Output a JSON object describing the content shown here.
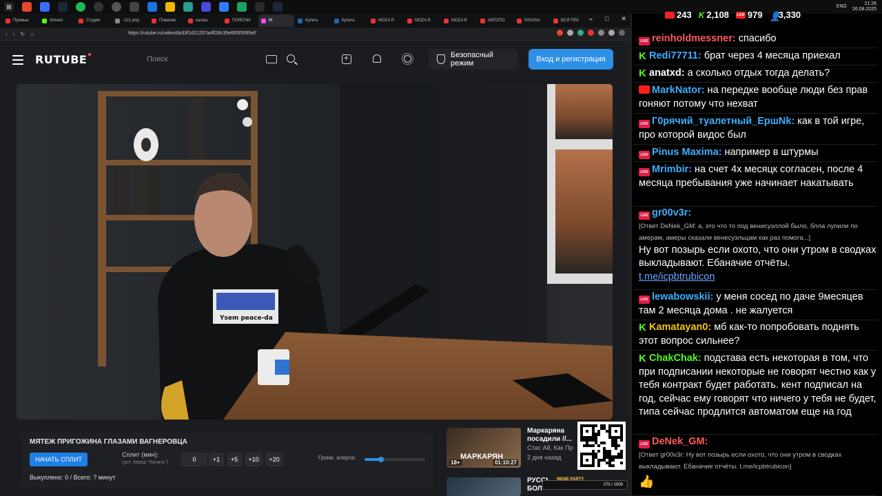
{
  "taskbar": {
    "clock_time": "21:26",
    "clock_date": "26.08.2025",
    "lang": "ENG"
  },
  "browser": {
    "tabs": [
      {
        "label": "Прямые",
        "color": "#e33"
      },
      {
        "label": "Stream",
        "color": "#53fc18"
      },
      {
        "label": "Студия",
        "color": "#e33"
      },
      {
        "label": "-221.png",
        "color": "#888"
      },
      {
        "label": "Поваляе",
        "color": "#e33"
      },
      {
        "label": "калаш",
        "color": "#e33"
      },
      {
        "label": "ПОЯСНИ",
        "color": "#e33"
      },
      {
        "label": "М",
        "color": "#f4f",
        "active": true
      },
      {
        "label": "Купить",
        "color": "#26a"
      },
      {
        "label": "Купить",
        "color": "#26a"
      },
      {
        "label": "MOZA R",
        "color": "#e33"
      },
      {
        "label": "MOZA R",
        "color": "#e33"
      },
      {
        "label": "MOZA R",
        "color": "#e33"
      },
      {
        "label": "АВТОПО",
        "color": "#e33"
      },
      {
        "label": "NISSAN",
        "color": "#e33"
      },
      {
        "label": "ВСЯ ПРА",
        "color": "#e33"
      }
    ],
    "url": "https://rutube.ru/video/da33f1d21207a4ff28c35e665f5595ef/"
  },
  "header": {
    "logo": "RUTUBE",
    "search_placeholder": "Поиск",
    "safe_mode_label": "Безопасный режим",
    "login_label": "Вход и регистрация"
  },
  "split": {
    "title": "МЯТЕЖ ПРИГОЖИНА ГЛАЗАМИ ВАГНЕРОВЦА",
    "start_label": "НАЧАТЬ СПЛИТ",
    "minutes_label": "Сплит (мин):",
    "minutes_hint": "(уст. перед \"Начать\")",
    "minutes_value": "0",
    "buttons": [
      "+1",
      "+5",
      "+10",
      "+20"
    ],
    "volume_label": "Громк. алерта:",
    "volume_level": 0.27,
    "status": "Выкуплено: 0 / Всего: ? минут"
  },
  "recommendations": [
    {
      "title": "Маркаряна посадили //...",
      "channel": "Стас Ай, Как Пр",
      "age": "2 дня назад",
      "thumb_text": "МАРКАРЯН",
      "age_badge": "18+",
      "duration": "01:10:27"
    },
    {
      "title": "РУССКИЕ БОЛ",
      "channel": "",
      "age": "",
      "thumb_text": "",
      "age_badge": "",
      "duration": ""
    }
  ],
  "meme_bar": {
    "title": "MEME PARTY",
    "progress": "270 / 1500"
  },
  "chat": {
    "stats": {
      "youtube": "243",
      "kick": "2,108",
      "live": "979",
      "viewers": "3,330"
    },
    "messages": [
      {
        "platform": "live",
        "nick": "reinholdmessner:",
        "nick_color": "#ff5a5a",
        "text": "спасибо"
      },
      {
        "platform": "kick",
        "nick": "Redi77711:",
        "nick_color": "#3ab0ff",
        "text": "брат через 4 месяца приехал"
      },
      {
        "platform": "kick",
        "nick": "anatxd:",
        "nick_color": "#ffffff",
        "text": "а сколько отдых тогда делать?"
      },
      {
        "platform": "yt",
        "nick": "MarkNator:",
        "nick_color": "#3ab0ff",
        "text": "на передке вообще люди без прав гоняют потому что нехват"
      },
      {
        "platform": "live",
        "nick": "Г0рячий_туалетный_ЕршNk:",
        "nick_color": "#3ab0ff",
        "text": "как в той игре, про которой видос был"
      },
      {
        "platform": "live",
        "nick": "Pinus Maxima:",
        "nick_color": "#3ab0ff",
        "text": "например в штурмы"
      },
      {
        "platform": "live",
        "nick": "Mrimbir:",
        "nick_color": "#3ab0ff",
        "text": "на счет 4х месяцк согласен, после 4 месяца пребывания уже начинает накатывать"
      },
      {
        "platform": "live",
        "nick": "gr00v3r:",
        "nick_color": "#3ab0ff",
        "reply": "[Ответ DeNek_GM: а, это что то под венисуэллой было, блла лупили по амерам, амеры сказали венесуэльцам как раз помога...]",
        "text": "Ну вот позырь если охото, что они утром в сводках выкладывают. Ебаначие отчёты.",
        "link": "t.me/icpbtrubicon"
      },
      {
        "platform": "live",
        "nick": "lewabowskii:",
        "nick_color": "#3ab0ff",
        "text": "у меня сосед по даче 9месяцев там 2 месяца дома . не жалуется"
      },
      {
        "platform": "kick",
        "nick": "Kamatayan0:",
        "nick_color": "#f5c518",
        "text": "мб как-то попробовать поднять этот вопрос сильнее?"
      },
      {
        "platform": "kick",
        "nick": "ChakChak:",
        "nick_color": "#53fc18",
        "text": "подстава есть некоторая в том, что при подписании некоторые не говорят честно как у тебя контракт будет работать. кент подписал на год, сейчас ему говорят что ничего у тебя не будет, типа сейчас продлится автоматом еще на год"
      },
      {
        "platform": "live",
        "nick": "DeNek_GM:",
        "nick_color": "#ff5a5a",
        "reply": "[Ответ gr00v3r: Ну вот позырь если охото, что они утром в сводках выкладывают. Ебаначие отчёты. t.me/icpbtrubicon]",
        "text": "👍"
      }
    ]
  }
}
